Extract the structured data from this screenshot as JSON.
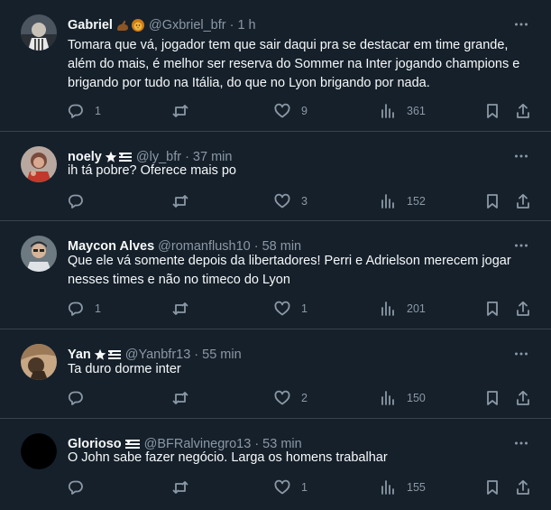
{
  "tweets": [
    {
      "name": "Gabriel",
      "badges": [
        "muscle-emoji",
        "lion-emoji"
      ],
      "handle": "@Gxbriel_bfr",
      "separator": "·",
      "time": "1 h",
      "lines": [
        "Tomara que vá, jogador tem que sair daqui pra se destacar em time grande,",
        "além do mais, é melhor ser reserva do Sommer na Inter jogando champions e",
        "brigando por tudo na Itália, do que no Lyon brigando por nada."
      ],
      "replies": "1",
      "retweets": "",
      "likes": "9",
      "views": "361"
    },
    {
      "name": "noely",
      "badges": [
        "star-emoji",
        "flag-emoji"
      ],
      "handle": "@ly_bfr",
      "separator": "·",
      "time": "37 min",
      "lines": [
        "ih tá pobre? Oferece mais po"
      ],
      "replies": "",
      "retweets": "",
      "likes": "3",
      "views": "152"
    },
    {
      "name": "Maycon Alves",
      "badges": [],
      "handle": "@romanflush10",
      "separator": "·",
      "time": "58 min",
      "lines": [
        "Que ele vá somente depois da libertadores! Perri e Adrielson merecem jogar",
        "nesses times e não no timeco do Lyon"
      ],
      "replies": "1",
      "retweets": "",
      "likes": "1",
      "views": "201"
    },
    {
      "name": "Yan",
      "badges": [
        "star-emoji",
        "flag-emoji"
      ],
      "handle": "@Yanbfr13",
      "separator": "·",
      "time": "55 min",
      "lines": [
        "Ta duro dorme inter"
      ],
      "replies": "",
      "retweets": "",
      "likes": "2",
      "views": "150"
    },
    {
      "name": "Glorioso",
      "badges": [
        "flag-emoji"
      ],
      "handle": "@BFRalvinegro13",
      "separator": "·",
      "time": "53 min",
      "lines": [
        "O John sabe fazer negócio. Larga os homens trabalhar"
      ],
      "replies": "",
      "retweets": "",
      "likes": "1",
      "views": "155"
    }
  ],
  "colors": {
    "background": "#15202b",
    "text": "#f7f9f9",
    "muted": "#8b98a5",
    "divider": "#38444d"
  }
}
